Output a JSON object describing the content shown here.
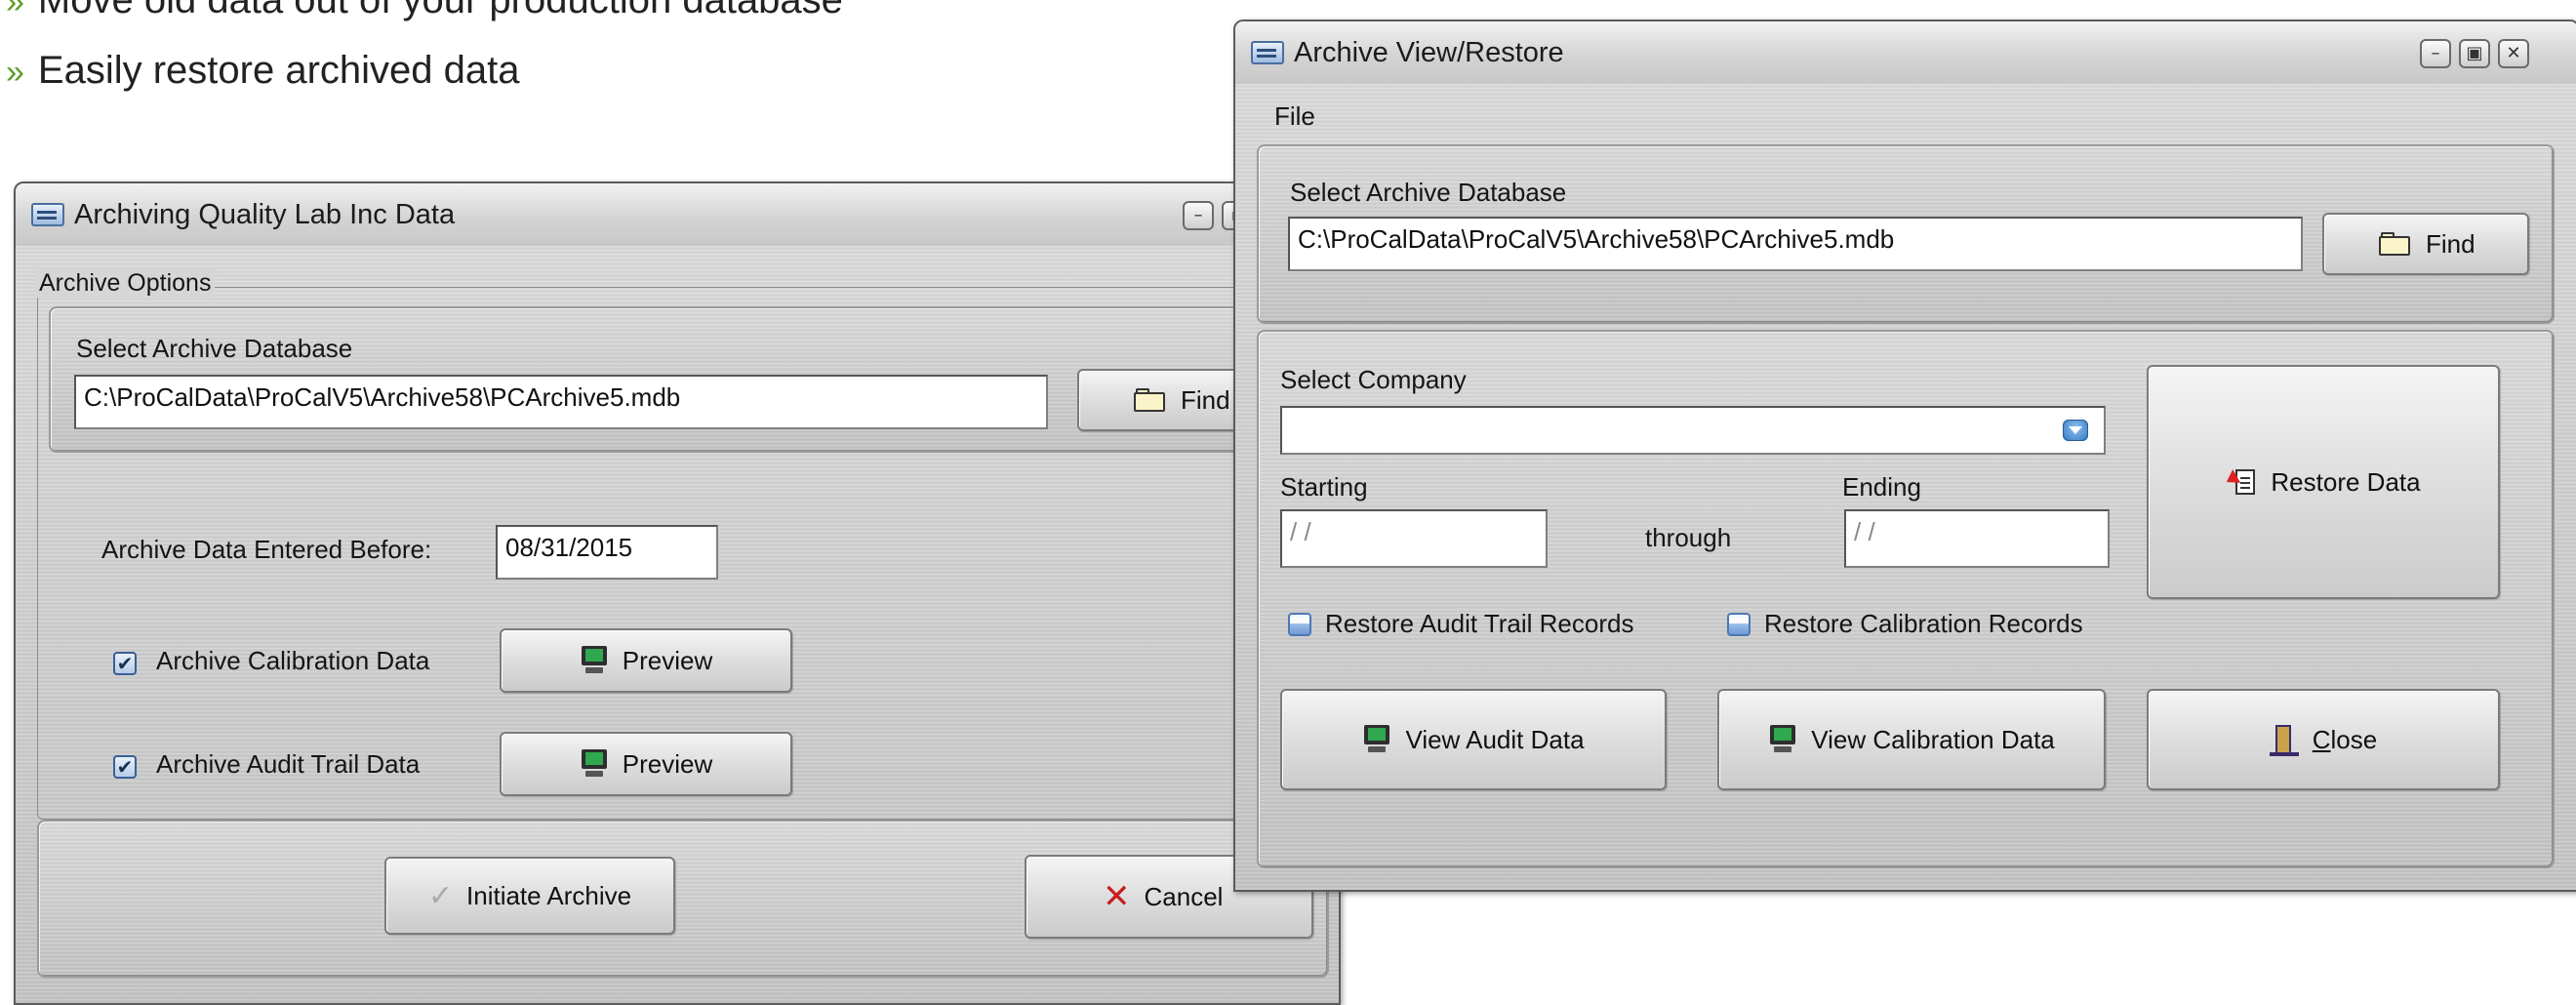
{
  "bullets": [
    {
      "text": "Move old data out of your production database"
    },
    {
      "text": "Easily restore archived data"
    }
  ],
  "bullet_glyph": "»",
  "colors": {
    "bullet": "#5a9e28",
    "cancel_x": "#c81e1e"
  },
  "archive_window": {
    "title": "Archiving Quality Lab Inc Data",
    "group_label": "Archive Options",
    "select_db_label": "Select Archive Database",
    "db_path": "C:\\ProCalData\\ProCalV5\\Archive58\\PCArchive5.mdb",
    "find_label": "Find",
    "entered_before_label": "Archive Data Entered Before:",
    "entered_before_value": "08/31/2015",
    "cal_check_label": "Archive Calibration Data",
    "cal_checked": true,
    "audit_check_label": "Archive Audit Trail Data",
    "audit_checked": true,
    "preview_label": "Preview",
    "initiate_label": "Initiate Archive",
    "cancel_label": "Cancel"
  },
  "restore_window": {
    "title": "Archive View/Restore",
    "menu_file": "File",
    "select_db_label": "Select Archive Database",
    "db_path": "C:\\ProCalData\\ProCalV5\\Archive58\\PCArchive5.mdb",
    "find_label": "Find",
    "select_company_label": "Select Company",
    "company_value": "",
    "starting_label": "Starting",
    "starting_value": " / /",
    "through_label": "through",
    "ending_label": "Ending",
    "ending_value": " / /",
    "restore_audit_label": "Restore Audit Trail Records",
    "restore_audit_checked": false,
    "restore_cal_label": "Restore Calibration Records",
    "restore_cal_checked": false,
    "restore_data_label": "Restore Data",
    "view_audit_label": "View Audit Data",
    "view_cal_label": "View Calibration Data",
    "close_label": "Close",
    "close_mnemonic": "C"
  }
}
